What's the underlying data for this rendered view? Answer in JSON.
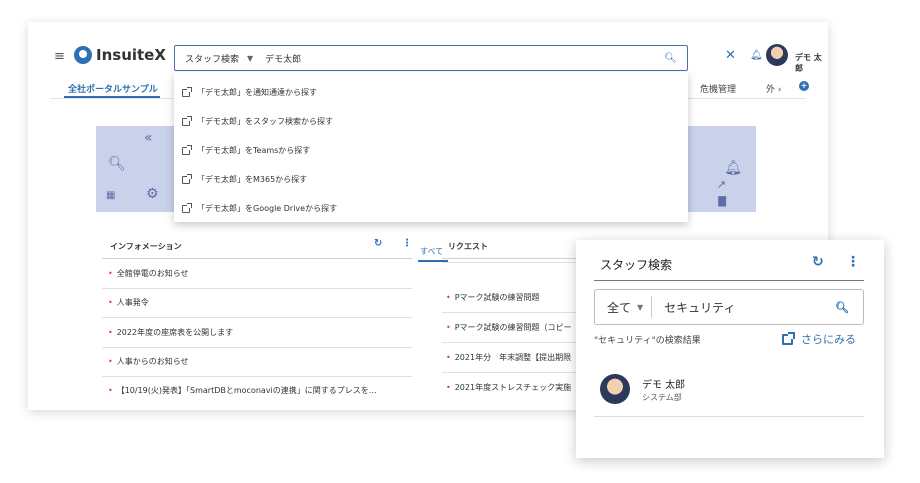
{
  "header": {
    "logo": "InsuiteX",
    "search": {
      "scope": "スタッフ検索",
      "value": "デモ太郎"
    },
    "user": "デモ 太郎"
  },
  "nav": {
    "tabs": [
      "全社ポータルサンプル",
      "危機管理",
      "外 ›"
    ]
  },
  "suggestions": [
    "「デモ太郎」を通知通達から探す",
    "「デモ太郎」をスタッフ検索から探す",
    "「デモ太郎」をTeamsから探す",
    "「デモ太郎」をM365から探す",
    "「デモ太郎」をGoogle Driveから探す"
  ],
  "information": {
    "title": "インフォメーション",
    "items": [
      "全館停電のお知らせ",
      "人事発令",
      "2022年度の座席表を公開します",
      "人事からのお知らせ",
      "【10/19(火)発表】「SmartDBとmoconaviの連携」に関するプレスを…"
    ]
  },
  "request": {
    "title": "リクエスト",
    "tab": "すべて",
    "items": [
      "Pマーク試験の練習問題",
      "Pマーク試験の練習問題（コピー",
      "2021年分　年末調整【提出期限",
      "2021年度ストレスチェック実施"
    ]
  },
  "staff_search": {
    "title": "スタッフ検索",
    "scope": "全て",
    "value": "セキュリティ",
    "result_label": "\"セキュリティ\"の検索結果",
    "more_label": "さらにみる",
    "result": {
      "name": "デモ 太郎",
      "dept": "システム部"
    }
  },
  "colors": {
    "accent": "#2f6fb4",
    "bullet": "#d6336c",
    "banner": "#7f8fc0"
  }
}
